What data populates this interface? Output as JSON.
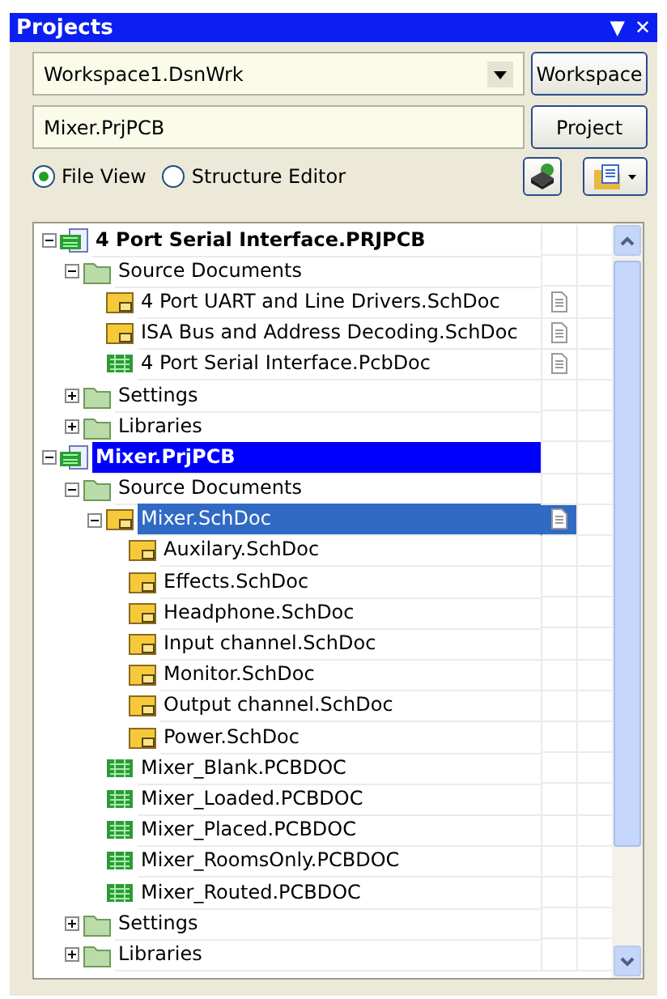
{
  "panel": {
    "title": "Projects",
    "menu_glyph": "▼",
    "close_glyph": "✕"
  },
  "workspace": {
    "value": "Workspace1.DsnWrk",
    "button": "Workspace"
  },
  "project": {
    "value": "Mixer.PrjPCB",
    "button": "Project"
  },
  "views": [
    {
      "label": "File View",
      "selected": true
    },
    {
      "label": "Structure Editor",
      "selected": false
    }
  ],
  "tree": [
    {
      "kind": "project",
      "label": "4 Port Serial Interface.PRJPCB",
      "selected": false,
      "expanded": true,
      "children": [
        {
          "kind": "folder",
          "label": "Source Documents",
          "selected": false,
          "expanded": true,
          "children": [
            {
              "kind": "sch",
              "label": "4 Port UART and Line Drivers.SchDoc",
              "selected": false,
              "open": true
            },
            {
              "kind": "sch",
              "label": "ISA Bus and Address Decoding.SchDoc",
              "selected": false,
              "open": true
            },
            {
              "kind": "pcb",
              "label": "4 Port Serial Interface.PcbDoc",
              "selected": false,
              "open": true
            }
          ]
        },
        {
          "kind": "folder",
          "label": "Settings",
          "selected": false,
          "expanded": false
        },
        {
          "kind": "folder",
          "label": "Libraries",
          "selected": false,
          "expanded": false
        }
      ]
    },
    {
      "kind": "project",
      "label": "Mixer.PrjPCB",
      "selected": true,
      "expanded": true,
      "children": [
        {
          "kind": "folder",
          "label": "Source Documents",
          "selected": false,
          "expanded": true,
          "children": [
            {
              "kind": "sch",
              "label": "Mixer.SchDoc",
              "selected": true,
              "open": true,
              "expanded": true,
              "children": [
                {
                  "kind": "sch",
                  "label": "Auxilary.SchDoc",
                  "selected": false,
                  "open": false
                },
                {
                  "kind": "sch",
                  "label": "Effects.SchDoc",
                  "selected": false,
                  "open": false
                },
                {
                  "kind": "sch",
                  "label": "Headphone.SchDoc",
                  "selected": false,
                  "open": false
                },
                {
                  "kind": "sch",
                  "label": "Input channel.SchDoc",
                  "selected": false,
                  "open": false
                },
                {
                  "kind": "sch",
                  "label": "Monitor.SchDoc",
                  "selected": false,
                  "open": false
                },
                {
                  "kind": "sch",
                  "label": "Output channel.SchDoc",
                  "selected": false,
                  "open": false
                },
                {
                  "kind": "sch",
                  "label": "Power.SchDoc",
                  "selected": false,
                  "open": false
                }
              ]
            },
            {
              "kind": "pcb",
              "label": "Mixer_Blank.PCBDOC",
              "selected": false,
              "open": false
            },
            {
              "kind": "pcb",
              "label": "Mixer_Loaded.PCBDOC",
              "selected": false,
              "open": false
            },
            {
              "kind": "pcb",
              "label": "Mixer_Placed.PCBDOC",
              "selected": false,
              "open": false
            },
            {
              "kind": "pcb",
              "label": "Mixer_RoomsOnly.PCBDOC",
              "selected": false,
              "open": false
            },
            {
              "kind": "pcb",
              "label": "Mixer_Routed.PCBDOC",
              "selected": false,
              "open": false
            }
          ]
        },
        {
          "kind": "folder",
          "label": "Settings",
          "selected": false,
          "expanded": false
        },
        {
          "kind": "folder",
          "label": "Libraries",
          "selected": false,
          "expanded": false
        }
      ]
    }
  ]
}
